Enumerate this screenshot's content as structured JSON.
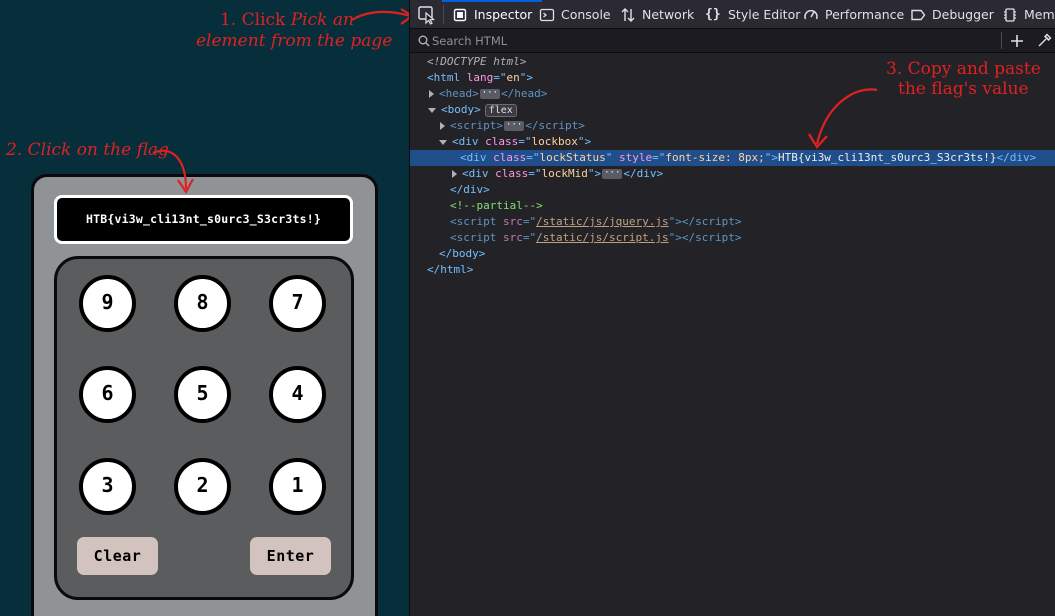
{
  "page": {
    "lock_status": "HTB{vi3w_cli13nt_s0urc3_S3cr3ts!}",
    "keypad": [
      "9",
      "8",
      "7",
      "6",
      "5",
      "4",
      "3",
      "2",
      "1"
    ],
    "clear_label": "Clear",
    "enter_label": "Enter"
  },
  "annotations": {
    "step1_prefix": "1. Click ",
    "step1_emph": "Pick an",
    "step1_line2": "element from the page",
    "step2": "2. Click on the flag",
    "step3_line1": "3. Copy and paste",
    "step3_line2": "the flag's value",
    "color": "#e02121"
  },
  "devtools": {
    "tabs": [
      {
        "label": "Inspector",
        "icon": "inspector-icon",
        "active": true
      },
      {
        "label": "Console",
        "icon": "console-icon"
      },
      {
        "label": "Network",
        "icon": "network-icon"
      },
      {
        "label": "Style Editor",
        "icon": "style-editor-icon"
      },
      {
        "label": "Performance",
        "icon": "performance-icon"
      },
      {
        "label": "Debugger",
        "icon": "debugger-icon"
      },
      {
        "label": "Memo",
        "icon": "memory-icon"
      }
    ],
    "search_placeholder": "Search HTML",
    "accent": "#0060df",
    "tree": {
      "doctype": "<!DOCTYPE html>",
      "html_tag": "html",
      "lang_attr": "lang",
      "lang_val": "en",
      "head_tag": "head",
      "body_tag": "body",
      "body_badge": "flex",
      "script_tag": "script",
      "div_tag": "div",
      "class_attr": "class",
      "lockbox_val": "lockbox",
      "lockstatus_val": "lockStatus",
      "style_attr": "style",
      "style_val": "font-size: 8px;",
      "flag_text": "HTB{vi3w_cli13nt_s0urc3_S3cr3ts!}",
      "lockmid_val": "lockMid",
      "comment": "<!--partial-->",
      "src_attr": "src",
      "src1": "/static/js/jquery.js",
      "src2": "/static/js/script.js"
    }
  }
}
